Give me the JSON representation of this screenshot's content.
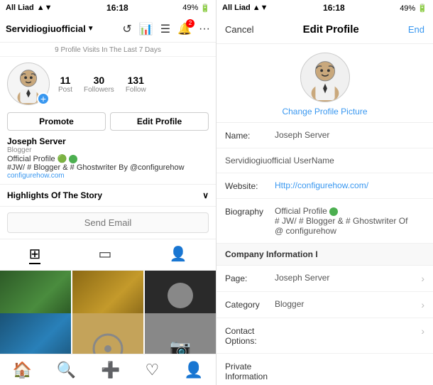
{
  "left": {
    "status_bar": {
      "carrier": "All Liad",
      "time": "16:18",
      "battery": "49%"
    },
    "nav": {
      "account_name": "Servidiogiuofficial",
      "icons": [
        "history",
        "chart",
        "list",
        "notification",
        "more"
      ]
    },
    "profile_visits": "9 Profile Visits In The Last 7 Days",
    "stats": [
      {
        "number": "11",
        "label": "Post"
      },
      {
        "number": "30",
        "label": "Followers"
      },
      {
        "number": "131",
        "label": "Follow"
      }
    ],
    "buttons": {
      "promote": "Promote",
      "edit_profile": "Edit Profile"
    },
    "user": {
      "name": "Joseph Server",
      "role": "Blogger",
      "description": "Official Profile 🟢",
      "tags": "#JW/ # Blogger & # Ghostwriter By @configurehow",
      "link": "configurehow.com"
    },
    "highlights": "Highlights Of The Story",
    "send_email_placeholder": "Send Email",
    "tabs": [
      "grid",
      "tablet",
      "person"
    ],
    "bottom_nav": [
      "home",
      "search",
      "add",
      "heart",
      "profile"
    ]
  },
  "right": {
    "status_bar": {
      "carrier": "All Liad",
      "time": "16:18",
      "battery": "49%"
    },
    "header": {
      "cancel": "Cancel",
      "title": "Edit Profile",
      "end": "End"
    },
    "profile_pic": {
      "change_text": "Change Profile Picture"
    },
    "fields": [
      {
        "label": "Name:",
        "value": "Joseph Server",
        "has_chevron": false
      },
      {
        "label": "Website:",
        "value": "Http://configurehow.com/",
        "has_chevron": false
      },
      {
        "label": "Biography",
        "value": "Official Profile ✅\n# JW/ # Blogger & # Ghostwriter Of\n@ configurehow",
        "has_chevron": false
      }
    ],
    "username_field": "Servidiogiuofficial UserName",
    "sections": [
      {
        "title": "Company Information I",
        "items": [
          {
            "label": "Page:",
            "value": "Joseph Server",
            "has_chevron": true
          },
          {
            "label": "Category",
            "value": "Blogger",
            "has_chevron": true
          }
        ]
      },
      {
        "title": "Contact Options:",
        "items": []
      },
      {
        "title": "Private Information",
        "items": []
      }
    ]
  }
}
